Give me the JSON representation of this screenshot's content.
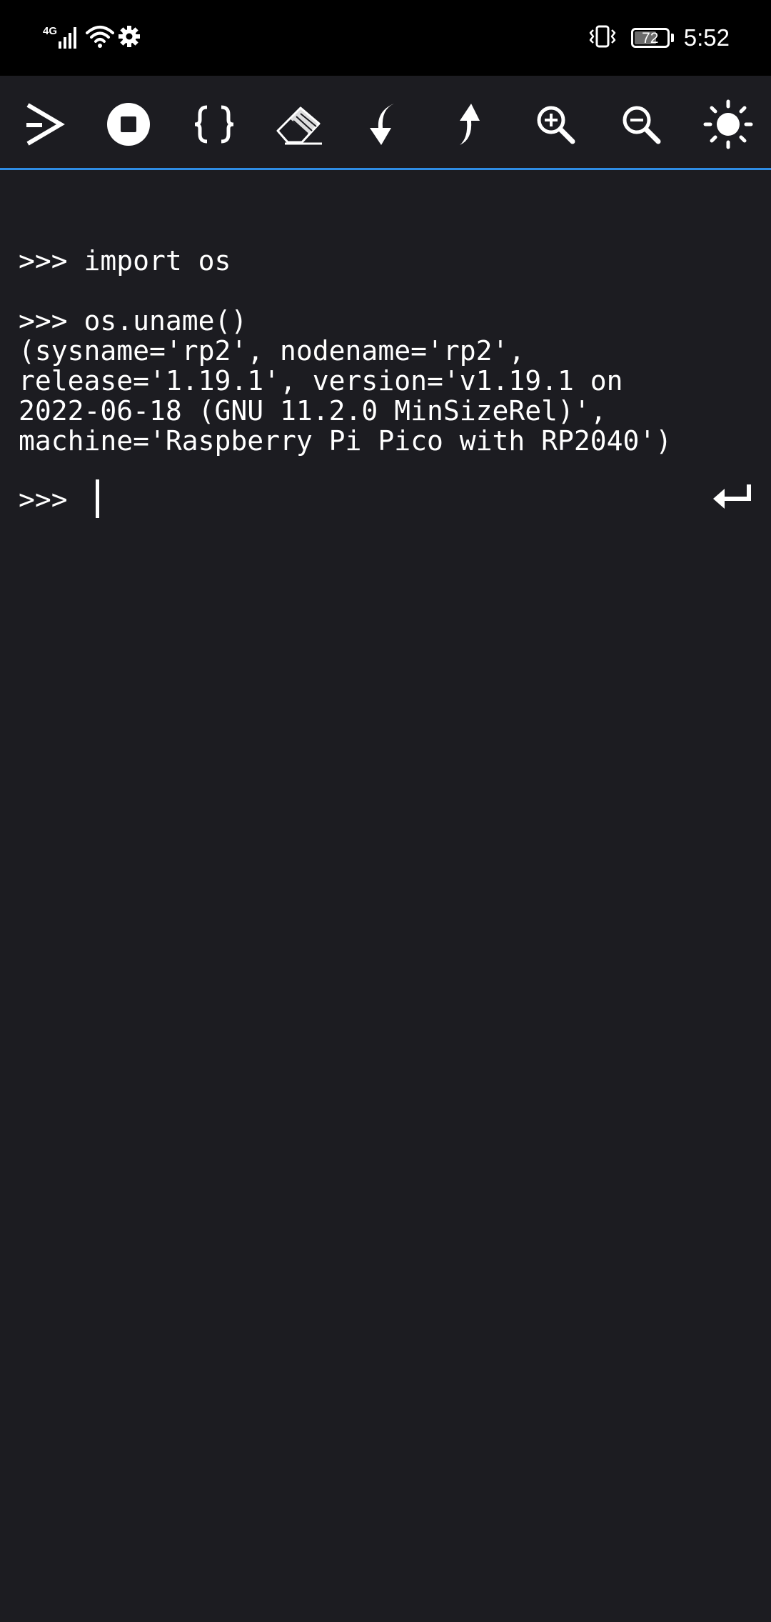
{
  "status_bar": {
    "network_type": "4G",
    "battery_level": 72,
    "battery_text": "72",
    "time": "5:52",
    "icons": [
      "signal-icon",
      "wifi-icon",
      "settings-gear-icon",
      "vibrate-icon",
      "battery-icon"
    ]
  },
  "toolbar": {
    "buttons": [
      {
        "name": "run-button",
        "icon": "run-chevron-icon"
      },
      {
        "name": "stop-button",
        "icon": "stop-icon"
      },
      {
        "name": "code-button",
        "icon": "braces-icon"
      },
      {
        "name": "clear-button",
        "icon": "eraser-icon"
      },
      {
        "name": "download-button",
        "icon": "arrow-down-icon"
      },
      {
        "name": "upload-button",
        "icon": "arrow-up-icon"
      },
      {
        "name": "zoom-in-button",
        "icon": "zoom-in-icon"
      },
      {
        "name": "zoom-out-button",
        "icon": "zoom-out-icon"
      },
      {
        "name": "brightness-button",
        "icon": "sun-icon"
      }
    ],
    "accent_color": "#2f8de4"
  },
  "terminal": {
    "lines": [
      ">>> import os",
      ">>> os.uname()",
      "(sysname='rp2', nodename='rp2',",
      "release='1.19.1', version='v1.19.1 on",
      "2022-06-18 (GNU 11.2.0 MinSizeRel)',",
      "machine='Raspberry Pi Pico with RP2040')"
    ],
    "prompt": ">>>",
    "input_value": "",
    "background": "#1c1c21",
    "text_color": "#ffffff"
  },
  "enter_icon": "enter-return-icon"
}
